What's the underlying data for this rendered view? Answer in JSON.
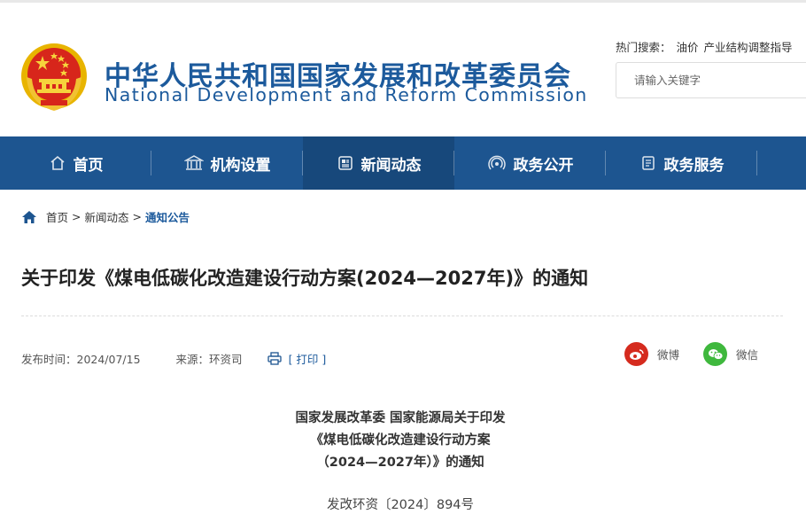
{
  "header": {
    "cn_title": "中华人民共和国国家发展和改革委员会",
    "en_title": "National Development and Reform Commission",
    "hot_search_label": "热门搜索：",
    "hot_search_items": [
      "油价",
      "产业结构调整指导"
    ],
    "search_placeholder": "请输入关键字"
  },
  "nav": {
    "items": [
      {
        "label": "首页",
        "icon": "home-icon"
      },
      {
        "label": "机构设置",
        "icon": "building-icon"
      },
      {
        "label": "新闻动态",
        "icon": "newspaper-icon",
        "active": true
      },
      {
        "label": "政务公开",
        "icon": "broadcast-icon"
      },
      {
        "label": "政务服务",
        "icon": "document-icon"
      }
    ]
  },
  "breadcrumb": {
    "home": "首页",
    "level1": "新闻动态",
    "current": "通知公告",
    "separator": ">"
  },
  "article": {
    "title": "关于印发《煤电低碳化改造建设行动方案(2024—2027年)》的通知",
    "publish_label": "发布时间：2024/07/15",
    "source_label": "来源：环资司",
    "print_label": "[ 打印 ]",
    "share_weibo": "微博",
    "share_wechat": "微信",
    "heading_lines": [
      "国家发展改革委 国家能源局关于印发",
      "《煤电低碳化改造建设行动方案",
      "（2024—2027年）》的通知"
    ],
    "doc_number": "发改环资〔2024〕894号"
  },
  "colors": {
    "brand_blue": "#1c5a9c",
    "nav_bg": "#1d5590",
    "nav_active": "#17487b",
    "weibo_red": "#d52b1e",
    "wechat_green": "#3fb83d"
  }
}
